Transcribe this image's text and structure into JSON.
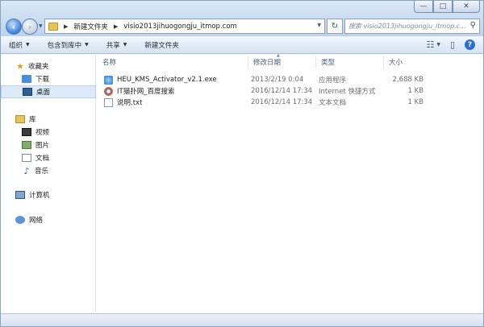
{
  "window": {
    "controls": {
      "minimize": "—",
      "maximize": "□",
      "close": "✕"
    }
  },
  "address": {
    "crumbs": [
      "新建文件夹",
      "visio2013jihuogongju_itmop.com"
    ]
  },
  "search": {
    "placeholder": "搜索 visio2013jihuogongju_itmop.c..."
  },
  "toolbar": {
    "organize": "组织",
    "include_in_library": "包含到库中",
    "share": "共享",
    "new_folder": "新建文件夹"
  },
  "navpane": {
    "favorites": "收藏夹",
    "downloads": "下载",
    "desktop": "桌面",
    "libraries": "库",
    "videos": "视频",
    "pictures": "图片",
    "documents": "文档",
    "music": "音乐",
    "computer": "计算机",
    "network": "网络"
  },
  "columns": {
    "name": "名称",
    "modified": "修改日期",
    "type": "类型",
    "size": "大小"
  },
  "files": [
    {
      "name": "HEU_KMS_Activator_v2.1.exe",
      "modified": "2013/2/19 0:04",
      "type": "应用程序",
      "size": "2,688 KB",
      "icon": "exe-icon"
    },
    {
      "name": "IT猫扑网_百度搜索",
      "modified": "2016/12/14 17:34",
      "type": "Internet 快捷方式",
      "size": "1 KB",
      "icon": "internet-shortcut-icon"
    },
    {
      "name": "说明.txt",
      "modified": "2016/12/14 17:34",
      "type": "文本文档",
      "size": "1 KB",
      "icon": "text-file-icon"
    }
  ]
}
